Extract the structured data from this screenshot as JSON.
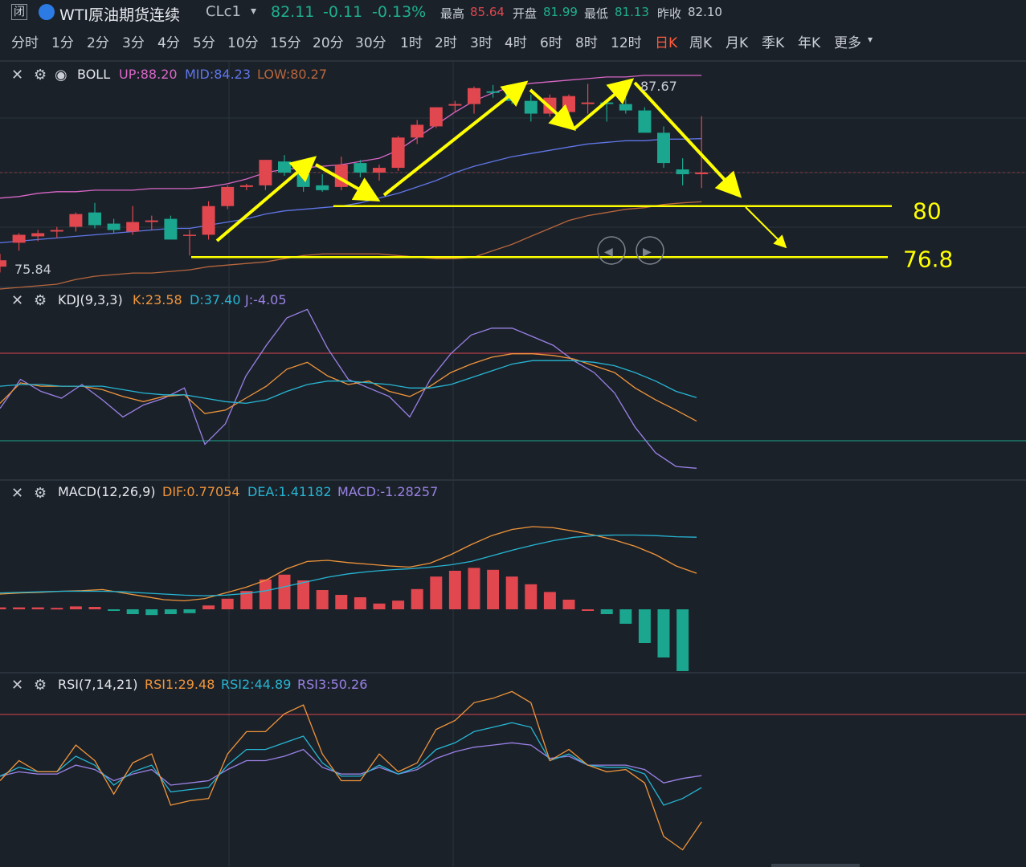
{
  "header": {
    "close_glyph": "闭",
    "title": "WTI原油期货连续",
    "code": "CLc1",
    "dropdown_glyph": "▾",
    "price": "82.11",
    "change": "-0.11",
    "change_pct": "-0.13%",
    "high_label": "最高",
    "high": "85.64",
    "open_label": "开盘",
    "open": "81.99",
    "low_label": "最低",
    "low": "81.13",
    "prev_label": "昨收",
    "prev": "82.10"
  },
  "timeframes": {
    "items": [
      "分时",
      "1分",
      "2分",
      "3分",
      "4分",
      "5分",
      "10分",
      "15分",
      "20分",
      "30分",
      "1时",
      "2时",
      "3时",
      "4时",
      "6时",
      "8时",
      "12时",
      "日K",
      "周K",
      "月K",
      "季K",
      "年K",
      "更多"
    ],
    "active": "日K",
    "more_arrow": "▾"
  },
  "colors": {
    "background": "#1b2129",
    "up": "#e0474f",
    "down": "#1aa68f",
    "grid": "#2a323c",
    "annotation": "#ffff00",
    "boll_up": "#d967c7",
    "boll_mid": "#5f76e8",
    "boll_low": "#b8663c",
    "kdj_k": "#f0953a",
    "kdj_d": "#26b6d4",
    "kdj_j": "#9a82e6",
    "rsi_overbought": "#d9434d",
    "rsi_oversold": "#1aa68f"
  },
  "panels": {
    "boll": {
      "name": "BOLL",
      "up": "UP:88.20",
      "mid": "MID:84.23",
      "low": "LOW:80.27",
      "max_label": "87.67",
      "min_label": "75.84"
    },
    "kdj": {
      "name": "KDJ(9,3,3)",
      "k": "K:23.58",
      "d": "D:37.40",
      "j": "J:-4.05"
    },
    "macd": {
      "name": "MACD(12,26,9)",
      "dif": "DIF:0.77054",
      "dea": "DEA:1.41182",
      "macd": "MACD:-1.28257"
    },
    "rsi": {
      "name": "RSI(7,14,21)",
      "rsi1": "RSI1:29.48",
      "rsi2": "RSI2:44.89",
      "rsi3": "RSI3:50.26"
    }
  },
  "annotations": {
    "level_80": "80",
    "level_76": "76.8"
  },
  "chart_data": {
    "type": "candlestick",
    "price_range": [
      75,
      89
    ],
    "candles": [
      {
        "o": 76.2,
        "h": 77.0,
        "l": 75.84,
        "c": 76.6
      },
      {
        "o": 77.7,
        "h": 78.3,
        "l": 77.2,
        "c": 78.2
      },
      {
        "o": 78.1,
        "h": 78.5,
        "l": 77.8,
        "c": 78.3
      },
      {
        "o": 78.4,
        "h": 78.7,
        "l": 78.0,
        "c": 78.5
      },
      {
        "o": 78.7,
        "h": 79.6,
        "l": 78.4,
        "c": 79.5
      },
      {
        "o": 79.6,
        "h": 80.2,
        "l": 78.6,
        "c": 78.8
      },
      {
        "o": 78.9,
        "h": 79.2,
        "l": 78.3,
        "c": 78.5
      },
      {
        "o": 78.4,
        "h": 80.0,
        "l": 78.2,
        "c": 79.0
      },
      {
        "o": 79.0,
        "h": 79.4,
        "l": 78.5,
        "c": 79.1
      },
      {
        "o": 79.2,
        "h": 79.4,
        "l": 77.9,
        "c": 77.9
      },
      {
        "o": 78.2,
        "h": 78.5,
        "l": 76.9,
        "c": 78.2
      },
      {
        "o": 78.2,
        "h": 80.3,
        "l": 77.9,
        "c": 80.0
      },
      {
        "o": 80.0,
        "h": 81.3,
        "l": 79.8,
        "c": 81.2
      },
      {
        "o": 81.2,
        "h": 81.4,
        "l": 81.0,
        "c": 81.3
      },
      {
        "o": 81.3,
        "h": 82.9,
        "l": 81.0,
        "c": 82.9
      },
      {
        "o": 82.8,
        "h": 83.2,
        "l": 81.9,
        "c": 82.1
      },
      {
        "o": 82.0,
        "h": 82.3,
        "l": 80.9,
        "c": 81.2
      },
      {
        "o": 81.3,
        "h": 82.0,
        "l": 80.9,
        "c": 81.0
      },
      {
        "o": 81.2,
        "h": 83.1,
        "l": 81.0,
        "c": 82.6
      },
      {
        "o": 82.7,
        "h": 82.9,
        "l": 81.8,
        "c": 82.1
      },
      {
        "o": 82.1,
        "h": 82.6,
        "l": 81.6,
        "c": 82.4
      },
      {
        "o": 82.4,
        "h": 84.4,
        "l": 82.2,
        "c": 84.3
      },
      {
        "o": 84.3,
        "h": 85.4,
        "l": 83.9,
        "c": 85.1
      },
      {
        "o": 85.0,
        "h": 86.2,
        "l": 84.9,
        "c": 86.2
      },
      {
        "o": 86.3,
        "h": 86.6,
        "l": 85.9,
        "c": 86.4
      },
      {
        "o": 86.4,
        "h": 87.5,
        "l": 85.8,
        "c": 87.4
      },
      {
        "o": 87.2,
        "h": 87.6,
        "l": 86.8,
        "c": 87.1
      },
      {
        "o": 87.2,
        "h": 87.4,
        "l": 86.4,
        "c": 86.6
      },
      {
        "o": 86.6,
        "h": 87.0,
        "l": 85.3,
        "c": 85.8
      },
      {
        "o": 85.8,
        "h": 87.0,
        "l": 85.6,
        "c": 86.8
      },
      {
        "o": 85.9,
        "h": 87.0,
        "l": 85.7,
        "c": 86.9
      },
      {
        "o": 86.4,
        "h": 87.67,
        "l": 85.8,
        "c": 86.5
      },
      {
        "o": 86.5,
        "h": 86.7,
        "l": 85.3,
        "c": 86.4
      },
      {
        "o": 86.4,
        "h": 86.8,
        "l": 85.8,
        "c": 86.0
      },
      {
        "o": 86.0,
        "h": 86.2,
        "l": 84.6,
        "c": 84.6
      },
      {
        "o": 84.6,
        "h": 85.0,
        "l": 82.4,
        "c": 82.7
      },
      {
        "o": 82.3,
        "h": 83.0,
        "l": 81.3,
        "c": 82.0
      },
      {
        "o": 82.0,
        "h": 85.64,
        "l": 81.13,
        "c": 82.11
      }
    ],
    "boll_up": [
      80.5,
      80.6,
      80.8,
      80.9,
      80.9,
      81.0,
      81.0,
      81.0,
      81.1,
      81.1,
      81.1,
      81.2,
      81.4,
      81.7,
      82.1,
      82.3,
      82.4,
      82.5,
      82.6,
      82.8,
      83.0,
      83.5,
      84.3,
      85.1,
      85.9,
      86.6,
      87.1,
      87.5,
      87.7,
      87.8,
      87.9,
      88.0,
      88.1,
      88.1,
      88.2,
      88.2,
      88.2,
      88.2
    ],
    "boll_mid": [
      77.7,
      77.8,
      77.9,
      78.0,
      78.1,
      78.2,
      78.3,
      78.4,
      78.5,
      78.6,
      78.6,
      78.8,
      79.0,
      79.2,
      79.5,
      79.7,
      79.8,
      79.9,
      80.0,
      80.2,
      80.5,
      80.8,
      81.2,
      81.6,
      82.1,
      82.5,
      82.8,
      83.1,
      83.3,
      83.5,
      83.7,
      83.9,
      84.0,
      84.1,
      84.1,
      84.2,
      84.2,
      84.23
    ],
    "boll_low": [
      74.8,
      74.9,
      75.0,
      75.1,
      75.4,
      75.6,
      75.7,
      75.8,
      75.8,
      75.9,
      76.0,
      76.2,
      76.3,
      76.4,
      76.5,
      76.7,
      76.9,
      77.0,
      77.0,
      77.0,
      77.0,
      76.9,
      76.8,
      76.7,
      76.7,
      76.8,
      77.2,
      77.6,
      78.1,
      78.6,
      79.1,
      79.4,
      79.6,
      79.8,
      79.9,
      80.1,
      80.2,
      80.27
    ],
    "kdj_k": [
      34,
      46,
      44,
      44,
      44,
      42,
      38,
      35,
      38,
      39,
      28,
      30,
      37,
      44,
      54,
      58,
      50,
      45,
      47,
      41,
      38,
      44,
      52,
      57,
      61,
      63,
      63,
      62,
      60,
      56,
      52,
      43,
      36,
      30,
      23.58
    ],
    "kdj_d": [
      44,
      45,
      45,
      44,
      44,
      44,
      42,
      40,
      39,
      39,
      37,
      35,
      34,
      36,
      41,
      45,
      47,
      47,
      46,
      45,
      43,
      43,
      45,
      49,
      53,
      57,
      59,
      59,
      59,
      58,
      56,
      52,
      47,
      41,
      37.4
    ],
    "kdj_j": [
      31,
      48,
      41,
      37,
      45,
      36,
      26,
      33,
      37,
      43,
      10,
      22,
      50,
      68,
      84,
      89,
      66,
      48,
      43,
      38,
      26,
      48,
      63,
      74,
      78,
      78,
      73,
      68,
      59,
      52,
      40,
      20,
      5,
      -3,
      -4.05
    ],
    "macd_dif": [
      0.4,
      0.42,
      0.43,
      0.45,
      0.46,
      0.48,
      0.42,
      0.36,
      0.3,
      0.28,
      0.32,
      0.42,
      0.52,
      0.65,
      0.85,
      0.98,
      1.0,
      0.96,
      0.93,
      0.9,
      0.88,
      0.95,
      1.1,
      1.28,
      1.44,
      1.55,
      1.6,
      1.58,
      1.52,
      1.45,
      1.36,
      1.25,
      1.1,
      0.9,
      0.77054
    ],
    "macd_dea": [
      0.42,
      0.43,
      0.44,
      0.45,
      0.45,
      0.45,
      0.44,
      0.42,
      0.4,
      0.38,
      0.37,
      0.38,
      0.41,
      0.46,
      0.54,
      0.62,
      0.7,
      0.76,
      0.8,
      0.83,
      0.85,
      0.88,
      0.92,
      0.98,
      1.08,
      1.18,
      1.27,
      1.35,
      1.41,
      1.44,
      1.45,
      1.45,
      1.44,
      1.42,
      1.41182
    ],
    "macd_hist": [
      0.04,
      0.04,
      0.04,
      0.03,
      0.06,
      0.05,
      -0.03,
      -0.1,
      -0.12,
      -0.1,
      -0.08,
      0.08,
      0.22,
      0.38,
      0.62,
      0.72,
      0.6,
      0.4,
      0.3,
      0.25,
      0.12,
      0.18,
      0.42,
      0.68,
      0.8,
      0.86,
      0.82,
      0.68,
      0.52,
      0.36,
      0.2,
      0.0,
      -0.1,
      -0.3,
      -0.7,
      -1.0,
      -1.28257
    ],
    "rsi1": [
      48,
      57,
      52,
      52,
      64,
      57,
      42,
      56,
      60,
      37,
      39,
      40,
      60,
      70,
      70,
      78,
      82,
      60,
      48,
      48,
      60,
      52,
      56,
      71,
      75,
      83,
      85,
      88,
      83,
      57,
      62,
      55,
      52,
      53,
      47,
      23,
      17,
      29.48
    ],
    "rsi2": [
      50,
      54,
      52,
      52,
      59,
      55,
      46,
      52,
      55,
      43,
      44,
      45,
      55,
      62,
      62,
      65,
      68,
      56,
      50,
      50,
      55,
      51,
      54,
      62,
      65,
      70,
      72,
      74,
      72,
      57,
      60,
      55,
      54,
      54,
      51,
      37,
      40,
      44.89
    ],
    "rsi3": [
      50,
      52,
      51,
      51,
      55,
      53,
      48,
      51,
      53,
      46,
      47,
      48,
      53,
      57,
      57,
      59,
      62,
      54,
      51,
      51,
      54,
      51,
      53,
      58,
      61,
      63,
      64,
      65,
      64,
      58,
      59,
      55,
      55,
      55,
      53,
      47,
      49,
      50.26
    ],
    "rsi_overbought": 80,
    "rsi_oversold": 20
  }
}
